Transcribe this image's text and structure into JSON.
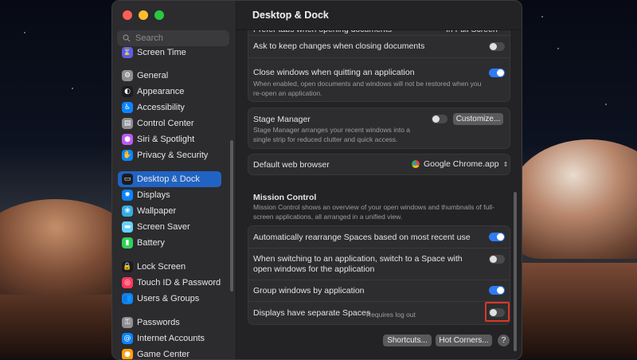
{
  "sidebar": {
    "search_placeholder": "Search",
    "items": [
      {
        "label": "Screen Time",
        "icon": "hourglass-icon",
        "color": "#5e5ce6",
        "glyph": "⌛"
      },
      {
        "label": "General",
        "icon": "gear-icon",
        "color": "#8e8e93",
        "glyph": "⚙"
      },
      {
        "label": "Appearance",
        "icon": "appearance-icon",
        "color": "#1c1c1e",
        "glyph": "◐"
      },
      {
        "label": "Accessibility",
        "icon": "accessibility-icon",
        "color": "#0a84ff",
        "glyph": "♿"
      },
      {
        "label": "Control Center",
        "icon": "control-center-icon",
        "color": "#8e8e93",
        "glyph": "▤"
      },
      {
        "label": "Siri & Spotlight",
        "icon": "siri-icon",
        "color": "#bf5af2",
        "glyph": "●"
      },
      {
        "label": "Privacy & Security",
        "icon": "hand-icon",
        "color": "#0a84ff",
        "glyph": "✋"
      },
      {
        "label": "Desktop & Dock",
        "icon": "dock-icon",
        "color": "#1c1c1e",
        "glyph": "▭",
        "active": true
      },
      {
        "label": "Displays",
        "icon": "displays-icon",
        "color": "#0a84ff",
        "glyph": "✹"
      },
      {
        "label": "Wallpaper",
        "icon": "wallpaper-icon",
        "color": "#32ade6",
        "glyph": "❀"
      },
      {
        "label": "Screen Saver",
        "icon": "screen-saver-icon",
        "color": "#64d2ff",
        "glyph": "▬"
      },
      {
        "label": "Battery",
        "icon": "battery-icon",
        "color": "#30d158",
        "glyph": "▮"
      },
      {
        "label": "Lock Screen",
        "icon": "lock-icon",
        "color": "#1c1c1e",
        "glyph": "🔒"
      },
      {
        "label": "Touch ID & Password",
        "icon": "fingerprint-icon",
        "color": "#ff375f",
        "glyph": "◎"
      },
      {
        "label": "Users & Groups",
        "icon": "users-icon",
        "color": "#0a84ff",
        "glyph": "👥"
      },
      {
        "label": "Passwords",
        "icon": "key-icon",
        "color": "#8e8e93",
        "glyph": "⚿"
      },
      {
        "label": "Internet Accounts",
        "icon": "at-icon",
        "color": "#0a84ff",
        "glyph": "@"
      },
      {
        "label": "Game Center",
        "icon": "game-center-icon",
        "color": "#ff9f0a",
        "glyph": "●"
      }
    ]
  },
  "header": {
    "title": "Desktop & Dock"
  },
  "windows_section": {
    "partial_label": "Prefer tabs when opening documents",
    "partial_value": "In Full Screen",
    "ask_label": "Ask to keep changes when closing documents",
    "close_label": "Close windows when quitting an application",
    "close_sub": "When enabled, open documents and windows will not be restored when you re-open an application."
  },
  "stage_manager": {
    "label": "Stage Manager",
    "sub": "Stage Manager arranges your recent windows into a single strip for reduced clutter and quick access.",
    "button": "Customize..."
  },
  "browser": {
    "label": "Default web browser",
    "value": "Google Chrome.app"
  },
  "mission_control": {
    "title": "Mission Control",
    "sub": "Mission Control shows an overview of your open windows and thumbnails of full-screen applications, all arranged in a unified view.",
    "rows": [
      {
        "label": "Automatically rearrange Spaces based on most recent use",
        "on": true
      },
      {
        "label": "When switching to an application, switch to a Space with open windows for the application",
        "on": false
      },
      {
        "label": "Group windows by application",
        "on": true
      },
      {
        "label": "Displays have separate Spaces",
        "note": "Requires log out",
        "on": false
      }
    ]
  },
  "footer": {
    "shortcuts": "Shortcuts...",
    "hot_corners": "Hot Corners...",
    "help": "?"
  },
  "colors": {
    "accent": "#2f7bf5",
    "selection": "#2163c3",
    "highlight": "#e03526"
  }
}
